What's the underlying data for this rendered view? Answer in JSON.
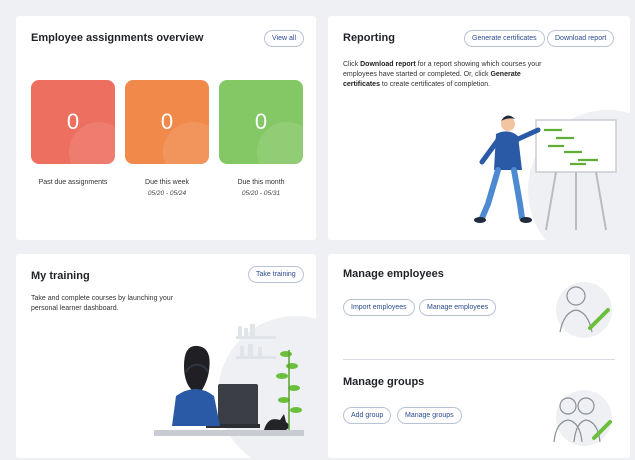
{
  "assignments": {
    "title": "Employee assignments overview",
    "view_all": "View all",
    "tiles": [
      {
        "value": "0",
        "label": "Past due assignments",
        "range": "",
        "color": "#ec6f5f"
      },
      {
        "value": "0",
        "label": "Due this week",
        "range": "05/20 - 05/24",
        "color": "#f0894a"
      },
      {
        "value": "0",
        "label": "Due this month",
        "range": "05/20 - 05/31",
        "color": "#84c866"
      }
    ]
  },
  "reporting": {
    "title": "Reporting",
    "generate_certificates": "Generate certificates",
    "download_report": "Download report",
    "desc_1": "Click ",
    "desc_bold_1": "Download report",
    "desc_2": " for a report showing which courses your employees have started or completed. Or, click ",
    "desc_bold_2": "Generate certificates",
    "desc_3": " to create certificates of completion."
  },
  "training": {
    "title": "My training",
    "take_training": "Take training",
    "description": "Take and complete courses by launching your personal learner dashboard."
  },
  "manage_employees": {
    "title": "Manage employees",
    "import": "Import employees",
    "manage": "Manage employees"
  },
  "manage_groups": {
    "title": "Manage groups",
    "add": "Add group",
    "manage": "Manage groups"
  },
  "colors": {
    "accent_text": "#2c4b8f",
    "pill_border": "#b9c3d6",
    "figure_blue": "#2a5aa6",
    "plant_green": "#6cbf3c"
  }
}
